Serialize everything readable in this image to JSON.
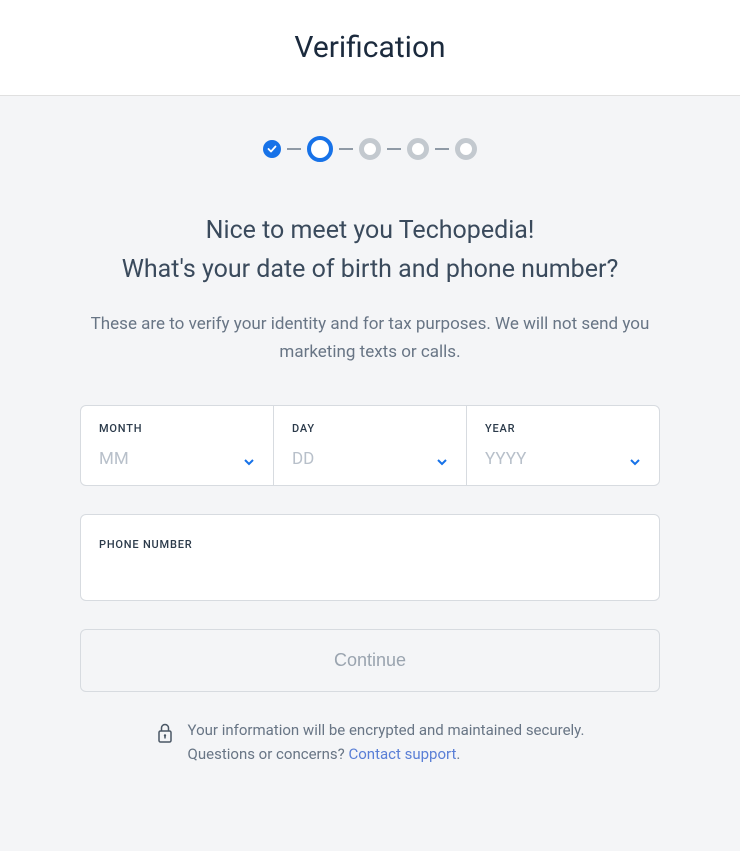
{
  "header": {
    "title": "Verification"
  },
  "progress": {
    "steps": [
      {
        "state": "complete"
      },
      {
        "state": "current"
      },
      {
        "state": "pending"
      },
      {
        "state": "pending"
      },
      {
        "state": "pending"
      }
    ]
  },
  "greeting_line1": "Nice to meet you Techopedia!",
  "greeting_line2": "What's your date of birth and phone number?",
  "subtext": "These are to verify your identity and for tax purposes. We will not send you marketing texts or calls.",
  "dob": {
    "month": {
      "label": "MONTH",
      "placeholder": "MM"
    },
    "day": {
      "label": "DAY",
      "placeholder": "DD"
    },
    "year": {
      "label": "YEAR",
      "placeholder": "YYYY"
    }
  },
  "phone": {
    "label": "PHONE NUMBER"
  },
  "continue_label": "Continue",
  "footer": {
    "secure_text": "Your information will be encrypted and maintained securely.",
    "question_prefix": "Questions or concerns? ",
    "support_link": "Contact support",
    "period": "."
  }
}
